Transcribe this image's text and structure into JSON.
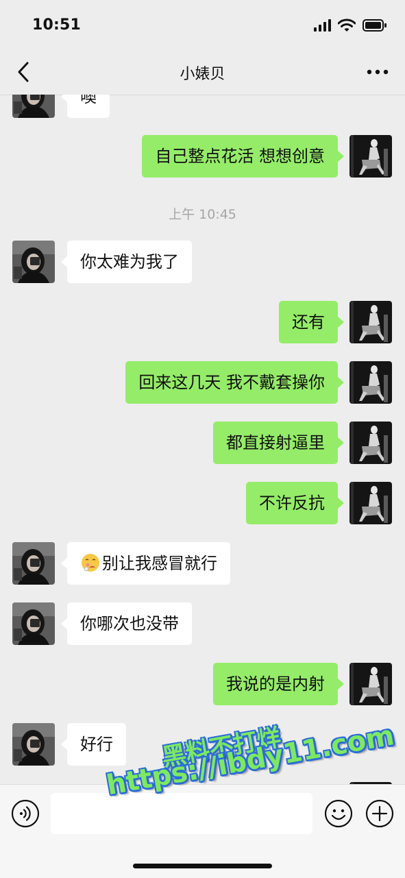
{
  "status_bar": {
    "time": "10:51"
  },
  "nav": {
    "title": "小婊贝",
    "back_icon": "chevron-left-icon",
    "more_icon": "more-dots-icon"
  },
  "messages": {
    "m0": "噢",
    "m1": "自己整点花活 想想创意",
    "ts": "上午 10:45",
    "m2": "你太难为我了",
    "m3": "还有",
    "m4": "回来这几天 我不戴套操你",
    "m5": "都直接射逼里",
    "m6": "不许反抗",
    "m7": "别让我感冒就行",
    "m8": "你哪次也没带",
    "m9": "我说的是内射",
    "m10": "好行"
  },
  "input_bar": {
    "text_value": "",
    "voice_icon": "voice-icon",
    "emoji_icon": "emoji-icon",
    "plus_icon": "plus-icon"
  },
  "watermark": {
    "line1": "黑料不打烊",
    "line2": "https://ibdy11.com"
  },
  "colors": {
    "background": "#EDEDED",
    "outgoing_bubble": "#95EC69",
    "incoming_bubble": "#FFFFFF",
    "timestamp": "#A5A5A5"
  }
}
